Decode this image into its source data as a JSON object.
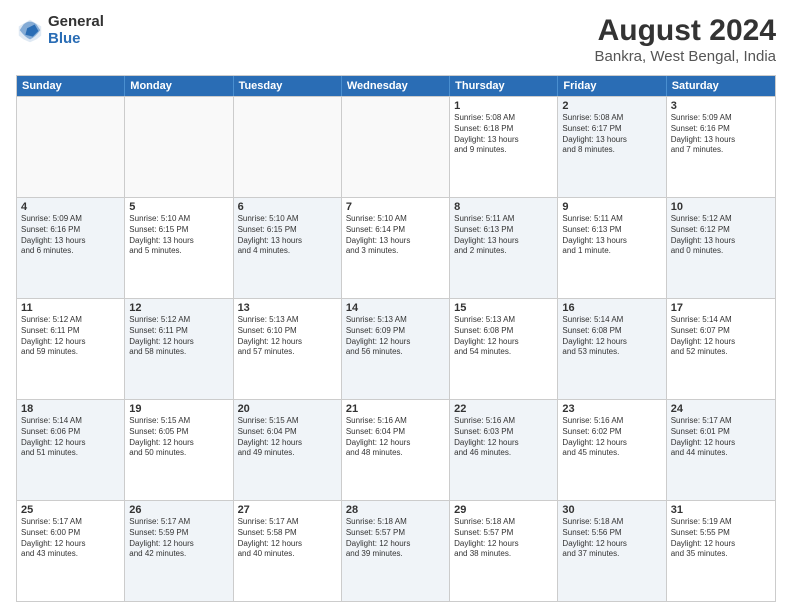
{
  "logo": {
    "general": "General",
    "blue": "Blue"
  },
  "title": "August 2024",
  "subtitle": "Bankra, West Bengal, India",
  "days": [
    "Sunday",
    "Monday",
    "Tuesday",
    "Wednesday",
    "Thursday",
    "Friday",
    "Saturday"
  ],
  "weeks": [
    [
      {
        "day": "",
        "content": "",
        "empty": true
      },
      {
        "day": "",
        "content": "",
        "empty": true
      },
      {
        "day": "",
        "content": "",
        "empty": true
      },
      {
        "day": "",
        "content": "",
        "empty": true
      },
      {
        "day": "1",
        "content": "Sunrise: 5:08 AM\nSunset: 6:18 PM\nDaylight: 13 hours\nand 9 minutes.",
        "shaded": false
      },
      {
        "day": "2",
        "content": "Sunrise: 5:08 AM\nSunset: 6:17 PM\nDaylight: 13 hours\nand 8 minutes.",
        "shaded": true
      },
      {
        "day": "3",
        "content": "Sunrise: 5:09 AM\nSunset: 6:16 PM\nDaylight: 13 hours\nand 7 minutes.",
        "shaded": false
      }
    ],
    [
      {
        "day": "4",
        "content": "Sunrise: 5:09 AM\nSunset: 6:16 PM\nDaylight: 13 hours\nand 6 minutes.",
        "shaded": true
      },
      {
        "day": "5",
        "content": "Sunrise: 5:10 AM\nSunset: 6:15 PM\nDaylight: 13 hours\nand 5 minutes.",
        "shaded": false
      },
      {
        "day": "6",
        "content": "Sunrise: 5:10 AM\nSunset: 6:15 PM\nDaylight: 13 hours\nand 4 minutes.",
        "shaded": true
      },
      {
        "day": "7",
        "content": "Sunrise: 5:10 AM\nSunset: 6:14 PM\nDaylight: 13 hours\nand 3 minutes.",
        "shaded": false
      },
      {
        "day": "8",
        "content": "Sunrise: 5:11 AM\nSunset: 6:13 PM\nDaylight: 13 hours\nand 2 minutes.",
        "shaded": true
      },
      {
        "day": "9",
        "content": "Sunrise: 5:11 AM\nSunset: 6:13 PM\nDaylight: 13 hours\nand 1 minute.",
        "shaded": false
      },
      {
        "day": "10",
        "content": "Sunrise: 5:12 AM\nSunset: 6:12 PM\nDaylight: 13 hours\nand 0 minutes.",
        "shaded": true
      }
    ],
    [
      {
        "day": "11",
        "content": "Sunrise: 5:12 AM\nSunset: 6:11 PM\nDaylight: 12 hours\nand 59 minutes.",
        "shaded": false
      },
      {
        "day": "12",
        "content": "Sunrise: 5:12 AM\nSunset: 6:11 PM\nDaylight: 12 hours\nand 58 minutes.",
        "shaded": true
      },
      {
        "day": "13",
        "content": "Sunrise: 5:13 AM\nSunset: 6:10 PM\nDaylight: 12 hours\nand 57 minutes.",
        "shaded": false
      },
      {
        "day": "14",
        "content": "Sunrise: 5:13 AM\nSunset: 6:09 PM\nDaylight: 12 hours\nand 56 minutes.",
        "shaded": true
      },
      {
        "day": "15",
        "content": "Sunrise: 5:13 AM\nSunset: 6:08 PM\nDaylight: 12 hours\nand 54 minutes.",
        "shaded": false
      },
      {
        "day": "16",
        "content": "Sunrise: 5:14 AM\nSunset: 6:08 PM\nDaylight: 12 hours\nand 53 minutes.",
        "shaded": true
      },
      {
        "day": "17",
        "content": "Sunrise: 5:14 AM\nSunset: 6:07 PM\nDaylight: 12 hours\nand 52 minutes.",
        "shaded": false
      }
    ],
    [
      {
        "day": "18",
        "content": "Sunrise: 5:14 AM\nSunset: 6:06 PM\nDaylight: 12 hours\nand 51 minutes.",
        "shaded": true
      },
      {
        "day": "19",
        "content": "Sunrise: 5:15 AM\nSunset: 6:05 PM\nDaylight: 12 hours\nand 50 minutes.",
        "shaded": false
      },
      {
        "day": "20",
        "content": "Sunrise: 5:15 AM\nSunset: 6:04 PM\nDaylight: 12 hours\nand 49 minutes.",
        "shaded": true
      },
      {
        "day": "21",
        "content": "Sunrise: 5:16 AM\nSunset: 6:04 PM\nDaylight: 12 hours\nand 48 minutes.",
        "shaded": false
      },
      {
        "day": "22",
        "content": "Sunrise: 5:16 AM\nSunset: 6:03 PM\nDaylight: 12 hours\nand 46 minutes.",
        "shaded": true
      },
      {
        "day": "23",
        "content": "Sunrise: 5:16 AM\nSunset: 6:02 PM\nDaylight: 12 hours\nand 45 minutes.",
        "shaded": false
      },
      {
        "day": "24",
        "content": "Sunrise: 5:17 AM\nSunset: 6:01 PM\nDaylight: 12 hours\nand 44 minutes.",
        "shaded": true
      }
    ],
    [
      {
        "day": "25",
        "content": "Sunrise: 5:17 AM\nSunset: 6:00 PM\nDaylight: 12 hours\nand 43 minutes.",
        "shaded": false
      },
      {
        "day": "26",
        "content": "Sunrise: 5:17 AM\nSunset: 5:59 PM\nDaylight: 12 hours\nand 42 minutes.",
        "shaded": true
      },
      {
        "day": "27",
        "content": "Sunrise: 5:17 AM\nSunset: 5:58 PM\nDaylight: 12 hours\nand 40 minutes.",
        "shaded": false
      },
      {
        "day": "28",
        "content": "Sunrise: 5:18 AM\nSunset: 5:57 PM\nDaylight: 12 hours\nand 39 minutes.",
        "shaded": true
      },
      {
        "day": "29",
        "content": "Sunrise: 5:18 AM\nSunset: 5:57 PM\nDaylight: 12 hours\nand 38 minutes.",
        "shaded": false
      },
      {
        "day": "30",
        "content": "Sunrise: 5:18 AM\nSunset: 5:56 PM\nDaylight: 12 hours\nand 37 minutes.",
        "shaded": true
      },
      {
        "day": "31",
        "content": "Sunrise: 5:19 AM\nSunset: 5:55 PM\nDaylight: 12 hours\nand 35 minutes.",
        "shaded": false
      }
    ]
  ]
}
